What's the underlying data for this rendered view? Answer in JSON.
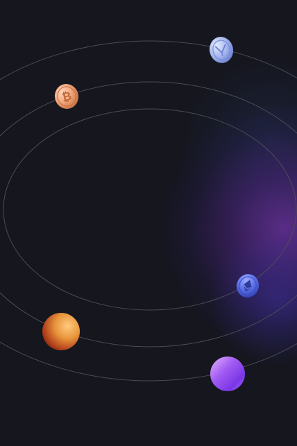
{
  "scene": {
    "background": "#15161e",
    "orbit_color": "#4a4c56",
    "glow_colors": [
      "#7034aa",
      "#3c32aa",
      "#283c6e"
    ]
  },
  "icons": {
    "bitcoin": "bitcoin-coin-icon",
    "silver": "silver-coin-icon",
    "ethereum": "ethereum-coin-icon",
    "orange_orb": "orange-sphere-icon",
    "violet_orb": "violet-sphere-icon"
  },
  "colors": {
    "bitcoin": "#f0a47a",
    "silver": "#a8b8ef",
    "ethereum": "#5a6ee6",
    "orange_orb": "#e8963c",
    "violet_orb": "#9a4ff0"
  }
}
